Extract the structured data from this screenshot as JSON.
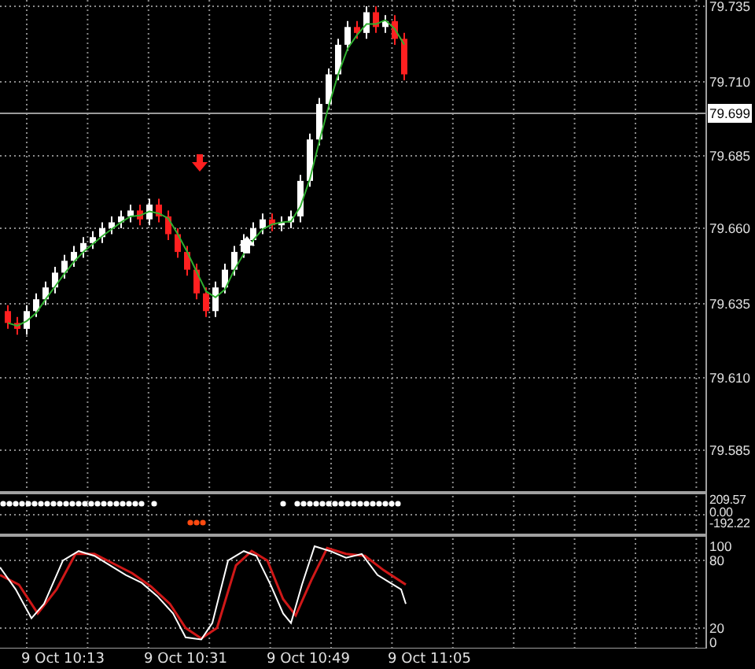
{
  "price_axis": {
    "labels": [
      "79.735",
      "79.710",
      "79.685",
      "79.660",
      "79.635",
      "79.610",
      "79.585"
    ],
    "current_price": "79.699"
  },
  "signal_pane": {
    "labels": [
      "209.57",
      "0.00",
      "-192.22"
    ]
  },
  "oscillator_pane": {
    "labels": [
      "100",
      "80",
      "20",
      "0"
    ]
  },
  "time_axis": {
    "labels": [
      "9 Oct 10:13",
      "9 Oct 10:31",
      "9 Oct 10:49",
      "9 Oct 11:05"
    ]
  }
}
